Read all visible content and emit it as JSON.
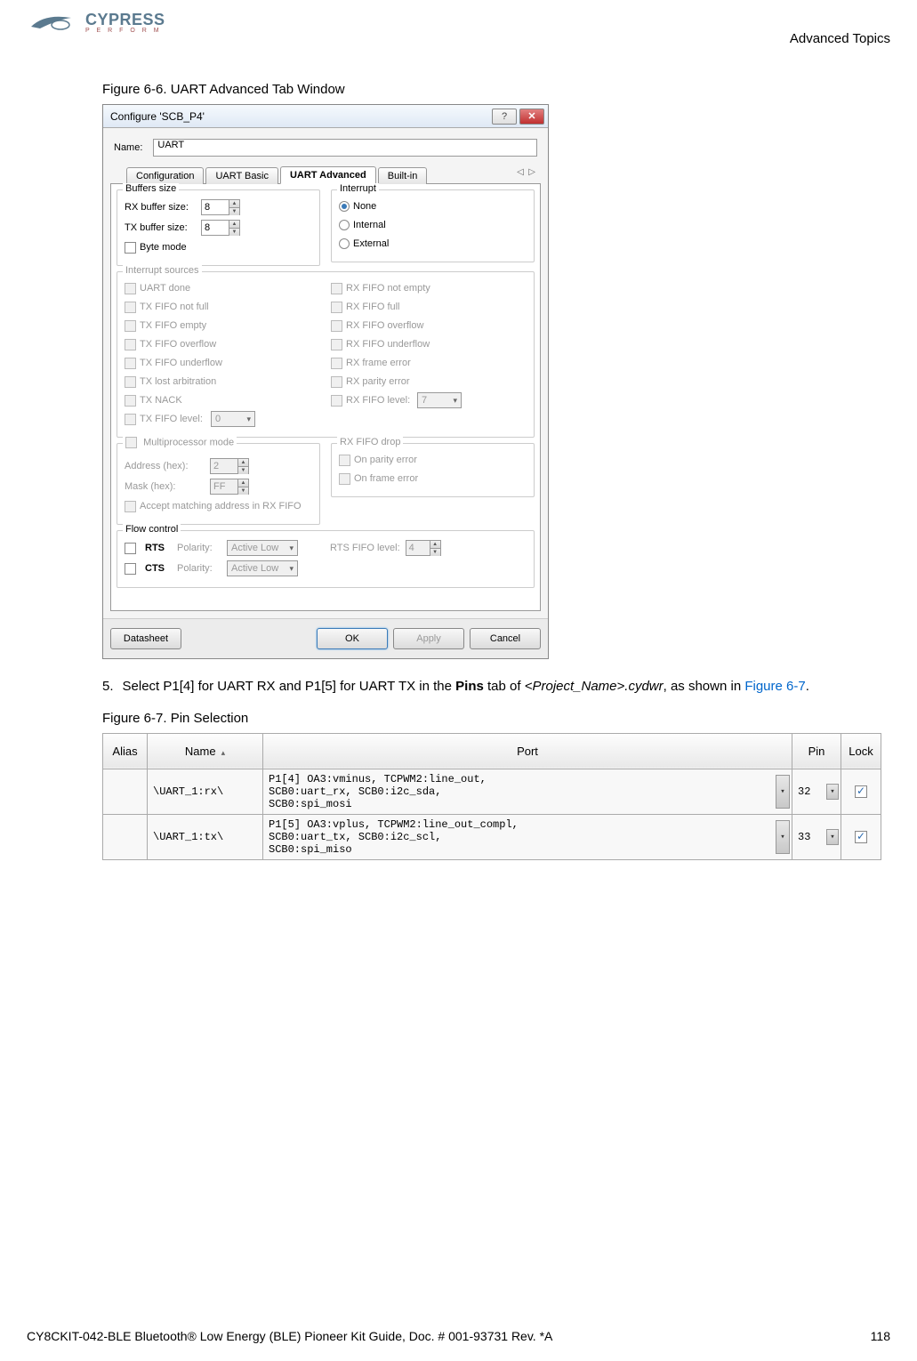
{
  "header": {
    "logo_brand": "CYPRESS",
    "logo_tag": "P E R F O R M",
    "section": "Advanced Topics"
  },
  "figure66": {
    "caption": "Figure 6-6.  UART Advanced Tab Window",
    "dialog": {
      "title": "Configure 'SCB_P4'",
      "name_label": "Name:",
      "name_value": "UART",
      "tabs": {
        "config": "Configuration",
        "basic": "UART Basic",
        "advanced": "UART Advanced",
        "builtin": "Built-in"
      },
      "buffers": {
        "title": "Buffers size",
        "rx_label": "RX buffer size:",
        "rx_value": "8",
        "tx_label": "TX buffer size:",
        "tx_value": "8",
        "byte_mode": "Byte mode"
      },
      "interrupt": {
        "title": "Interrupt",
        "none": "None",
        "internal": "Internal",
        "external": "External"
      },
      "sources": {
        "title": "Interrupt sources",
        "uart_done": "UART done",
        "tx_not_full": "TX FIFO not full",
        "tx_empty": "TX FIFO empty",
        "tx_overflow": "TX FIFO overflow",
        "tx_underflow": "TX FIFO underflow",
        "tx_lost_arb": "TX lost arbitration",
        "tx_nack": "TX NACK",
        "tx_level": "TX FIFO level:",
        "tx_level_val": "0",
        "rx_not_empty": "RX FIFO not empty",
        "rx_full": "RX FIFO full",
        "rx_overflow": "RX FIFO overflow",
        "rx_underflow": "RX FIFO underflow",
        "rx_frame_err": "RX frame error",
        "rx_parity_err": "RX parity error",
        "rx_level": "RX FIFO level:",
        "rx_level_val": "7"
      },
      "multi": {
        "title": "Multiprocessor mode",
        "addr_label": "Address (hex):",
        "addr_val": "2",
        "mask_label": "Mask (hex):",
        "mask_val": "FF",
        "accept": "Accept matching address in RX FIFO"
      },
      "fifo_drop": {
        "title": "RX FIFO drop",
        "parity": "On parity error",
        "frame": "On frame error"
      },
      "flow": {
        "title": "Flow control",
        "rts": "RTS",
        "cts": "CTS",
        "polarity": "Polarity:",
        "active_low": "Active Low",
        "rts_level": "RTS FIFO level:",
        "rts_level_val": "4"
      },
      "buttons": {
        "datasheet": "Datasheet",
        "ok": "OK",
        "apply": "Apply",
        "cancel": "Cancel"
      }
    }
  },
  "step5": {
    "num": "5.",
    "text_a": "Select P1[4] for UART RX and P1[5] for UART TX in the ",
    "bold": "Pins",
    "text_b": " tab of ",
    "italic": "<Project_Name>.cydwr",
    "text_c": ", as shown in ",
    "link": "Figure 6-7",
    "text_d": "."
  },
  "figure67": {
    "caption": "Figure 6-7.  Pin Selection",
    "headers": {
      "alias": "Alias",
      "name": "Name",
      "port": "Port",
      "pin": "Pin",
      "lock": "Lock"
    },
    "rows": [
      {
        "name": "\\UART_1:rx\\",
        "port": "P1[4] OA3:vminus, TCPWM2:line_out,\nSCB0:uart_rx, SCB0:i2c_sda,\nSCB0:spi_mosi",
        "pin": "32"
      },
      {
        "name": "\\UART_1:tx\\",
        "port": "P1[5] OA3:vplus, TCPWM2:line_out_compl,\nSCB0:uart_tx, SCB0:i2c_scl,\nSCB0:spi_miso",
        "pin": "33"
      }
    ]
  },
  "footer": {
    "doc": "CY8CKIT-042-BLE Bluetooth® Low Energy (BLE) Pioneer Kit Guide, Doc. # 001-93731 Rev. *A",
    "page": "118"
  }
}
